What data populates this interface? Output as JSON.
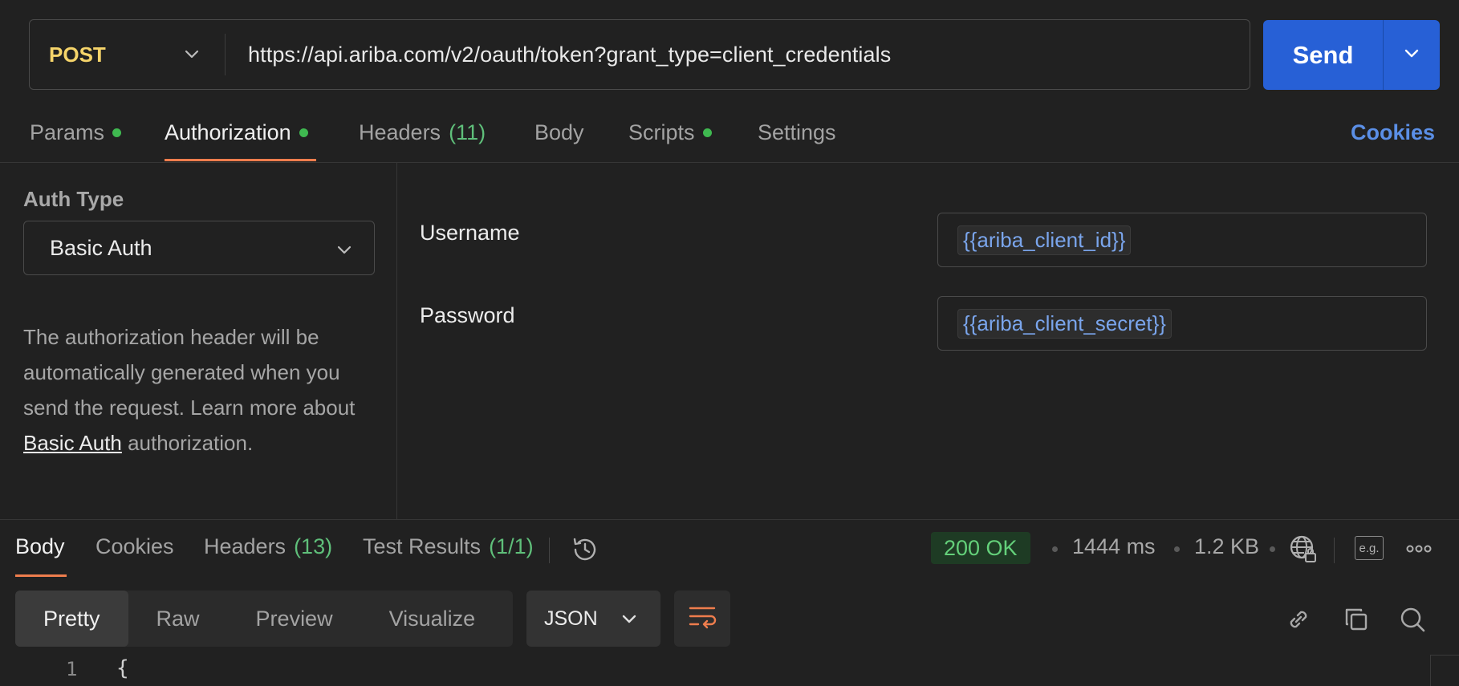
{
  "request": {
    "method": "POST",
    "url": "https://api.ariba.com/v2/oauth/token?grant_type=client_credentials",
    "send_label": "Send"
  },
  "request_tabs": [
    {
      "label": "Params",
      "dot": true
    },
    {
      "label": "Authorization",
      "dot": true,
      "active": true
    },
    {
      "label": "Headers",
      "count": "(11)"
    },
    {
      "label": "Body"
    },
    {
      "label": "Scripts",
      "dot": true
    },
    {
      "label": "Settings"
    }
  ],
  "cookies_link": "Cookies",
  "auth": {
    "type_label": "Auth Type",
    "type_value": "Basic Auth",
    "description_before": "The authorization header will be automatically generated when you send the request. Learn more about ",
    "description_link": "Basic Auth",
    "description_after": " authorization.",
    "username_label": "Username",
    "username_value": "{{ariba_client_id}}",
    "password_label": "Password",
    "password_value": "{{ariba_client_secret}}"
  },
  "response": {
    "tabs": [
      {
        "label": "Body",
        "active": true
      },
      {
        "label": "Cookies"
      },
      {
        "label": "Headers",
        "count": "(13)"
      },
      {
        "label": "Test Results",
        "count": "(1/1)"
      }
    ],
    "status": "200 OK",
    "time": "1444 ms",
    "size": "1.2 KB",
    "example_label": "e.g.",
    "view_modes": [
      "Pretty",
      "Raw",
      "Preview",
      "Visualize"
    ],
    "active_view": "Pretty",
    "format": "JSON",
    "code_lines": [
      {
        "num": "1",
        "text": "{"
      }
    ]
  },
  "colors": {
    "accent_tab": "#ee7d4d",
    "send_button": "#2760d6",
    "method": "#f5d46a",
    "status_ok": "#64d07a",
    "variable": "#7aa5ec",
    "dot": "#3fb950"
  },
  "icons": [
    "chevron-down-icon",
    "history-icon",
    "globe-lock-icon",
    "more-icon",
    "wrap-lines-icon",
    "link-icon",
    "copy-icon",
    "search-icon"
  ]
}
